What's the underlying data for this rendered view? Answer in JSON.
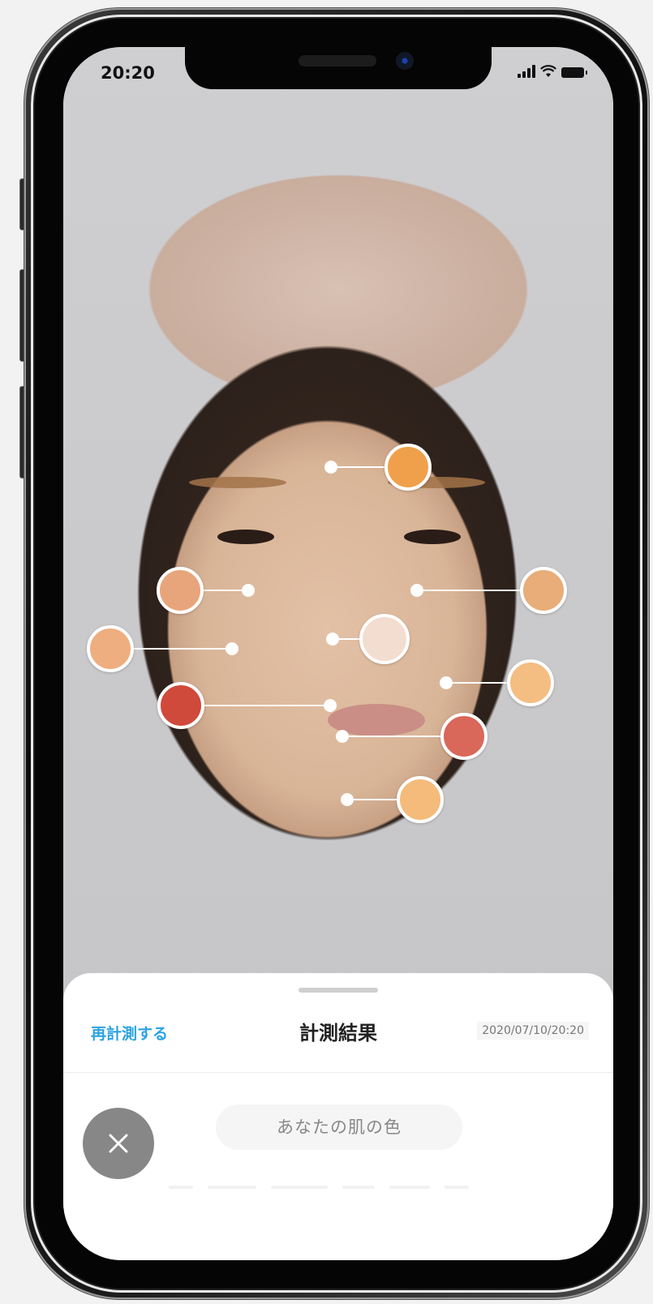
{
  "status_bar": {
    "time": "20:20",
    "icons": [
      "signal-icon",
      "wifi-icon",
      "battery-icon"
    ]
  },
  "sheet": {
    "remeasure_label": "再計測する",
    "title": "計測結果",
    "timestamp": "2020/07/10/20:20",
    "skin_color_pill": "あなたの肌の色"
  },
  "close_button": {
    "icon": "close-icon"
  },
  "measure_points": [
    {
      "name": "forehead",
      "color": "#f0a04b"
    },
    {
      "name": "right-cheek-upper",
      "color": "#e8a57c"
    },
    {
      "name": "left-cheek-upper",
      "color": "#e8ad78"
    },
    {
      "name": "nose",
      "color": "#f2ddd0"
    },
    {
      "name": "right-cheek-outer",
      "color": "#efae7f"
    },
    {
      "name": "left-cheek-lower",
      "color": "#f4bd82"
    },
    {
      "name": "mouth-corner",
      "color": "#cf4a3a"
    },
    {
      "name": "lower-lip",
      "color": "#d9675a"
    },
    {
      "name": "chin",
      "color": "#f4bb7a"
    }
  ],
  "accent_color": "#2aa3e0"
}
